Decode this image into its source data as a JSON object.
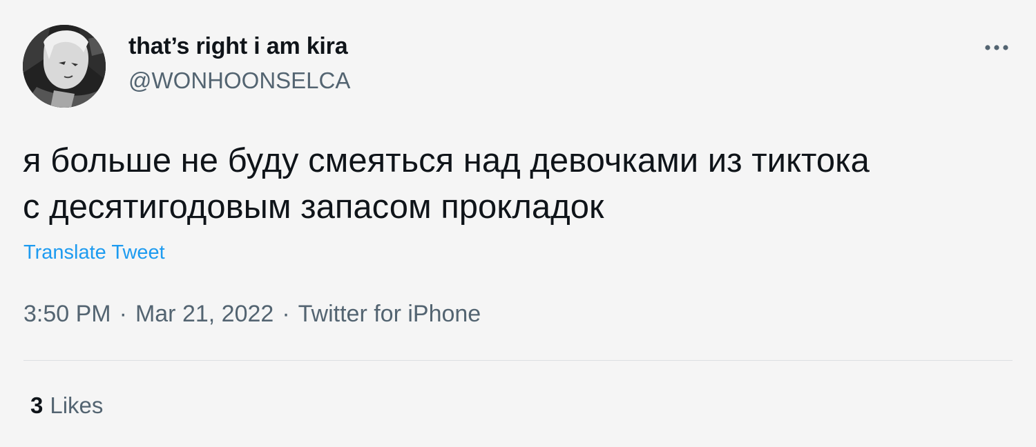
{
  "author": {
    "display_name": "that’s right i am kira",
    "handle": "@WONHOONSELCA",
    "avatar_icon": "user-avatar"
  },
  "more_icon": "more-options-icon",
  "tweet": {
    "text": "я больше не буду смеяться над девочками из тиктока\nс десятигодовым запасом прокладок",
    "translate_label": "Translate Tweet"
  },
  "meta": {
    "time": "3:50 PM",
    "separator": "·",
    "date": "Mar 21, 2022",
    "source": "Twitter for iPhone"
  },
  "stats": {
    "likes_count": "3",
    "likes_label": "Likes"
  },
  "colors": {
    "background": "#f5f5f5",
    "text_primary": "#0f1419",
    "text_secondary": "#536471",
    "link": "#1d9bf0",
    "divider": "#dcdfe2"
  }
}
